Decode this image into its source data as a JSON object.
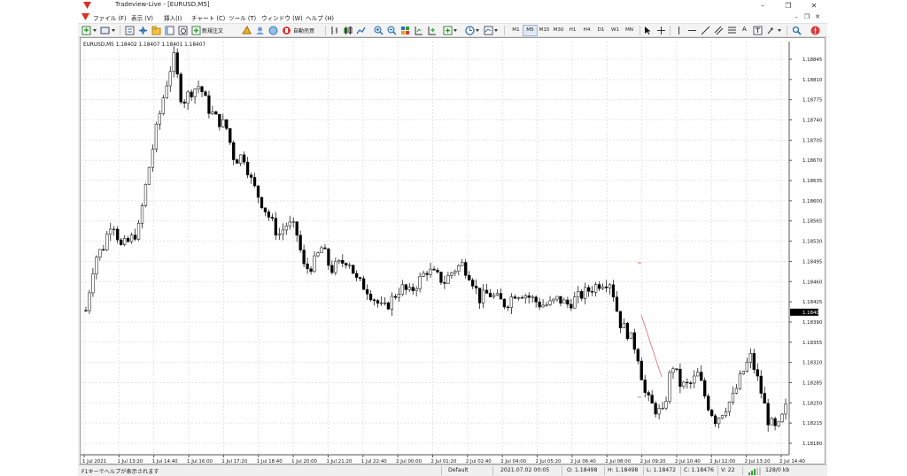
{
  "window": {
    "title": "Tradeview-Live - [EURUSD,M5]"
  },
  "menu": [
    {
      "label": "ファイル (F)"
    },
    {
      "label": "表示 (V)"
    },
    {
      "label": "挿入(I)"
    },
    {
      "label": "チャート (C)"
    },
    {
      "label": "ツール (T)"
    },
    {
      "label": "ウィンドウ (W)"
    },
    {
      "label": "ヘルプ (H)"
    }
  ],
  "toolbar": {
    "new_order_label": "新規注文",
    "auto_trade_label": "自動売買",
    "timeframes": [
      "M1",
      "M5",
      "M15",
      "M30",
      "H1",
      "H4",
      "D1",
      "W1",
      "MN"
    ],
    "active_timeframe": "M5",
    "text_tool_label": "A"
  },
  "chart": {
    "header": "EURUSD,M5  1.18402 1.18407 1.18401 1.18407",
    "current_price_label": "1.18407",
    "colors": {
      "bull": "#ffffff",
      "bear": "#000000",
      "wick": "#000000",
      "grid": "#e4e4e4",
      "price_tag": "#000000"
    }
  },
  "chart_data": {
    "type": "candlestick",
    "symbol": "EURUSD",
    "timeframe": "M5",
    "ylim": [
      1.1816,
      1.1888
    ],
    "y_ticks": [
      "1.18845",
      "1.18810",
      "1.18775",
      "1.18740",
      "1.18705",
      "1.18670",
      "1.18635",
      "1.18600",
      "1.18565",
      "1.18530",
      "1.18495",
      "1.18460",
      "1.18425",
      "1.18390",
      "1.18355",
      "1.18320",
      "1.18285",
      "1.18250",
      "1.18215",
      "1.18180"
    ],
    "x_ticks": [
      "1 Jul 2021",
      "1 Jul 13:20",
      "1 Jul 14:40",
      "1 Jul 16:00",
      "1 Jul 17:20",
      "1 Jul 18:40",
      "1 Jul 20:00",
      "1 Jul 21:20",
      "1 Jul 22:40",
      "2 Jul 00:00",
      "2 Jul 01:20",
      "2 Jul 02:40",
      "2 Jul 04:00",
      "2 Jul 05:20",
      "2 Jul 06:40",
      "2 Jul 08:00",
      "2 Jul 09:20",
      "2 Jul 10:40",
      "2 Jul 12:00",
      "2 Jul 13:20",
      "2 Jul 14:40"
    ],
    "close_path": [
      1.1841,
      1.185,
      1.1852,
      1.1857,
      1.1852,
      1.1853,
      1.1855,
      1.1864,
      1.1872,
      1.1879,
      1.1885,
      1.1877,
      1.1879,
      1.188,
      1.1876,
      1.1874,
      1.1873,
      1.1867,
      1.1868,
      1.1863,
      1.186,
      1.1857,
      1.1854,
      1.1856,
      1.1855,
      1.1848,
      1.1849,
      1.1852,
      1.1848,
      1.1849,
      1.185,
      1.1846,
      1.1845,
      1.1843,
      1.1841,
      1.1843,
      1.1845,
      1.1844,
      1.1846,
      1.1848,
      1.1847,
      1.1846,
      1.1848,
      1.1849,
      1.1847,
      1.1843,
      1.1844,
      1.1843,
      1.1842,
      1.1844,
      1.1844,
      1.1843,
      1.1842,
      1.1842,
      1.1843,
      1.1842,
      1.1843,
      1.1844,
      1.1845,
      1.1846,
      1.1846,
      1.1839,
      1.1837,
      1.1834,
      1.1826,
      1.1824,
      1.1823,
      1.1832,
      1.1828,
      1.1828,
      1.183,
      1.1825,
      1.1822,
      1.1824,
      1.1826,
      1.183,
      1.1833,
      1.1828,
      1.1822,
      1.182,
      1.1824
    ]
  },
  "status": {
    "help": "F1キーでヘルプが表示されます",
    "profile": "Default",
    "datetime": "2021.07.02 00:05",
    "open": "O: 1.18498",
    "high": "H: 1.18498",
    "low": "L: 1.18472",
    "close": "C: 1.18476",
    "volume": "V: 22",
    "traffic": "128/0 kb"
  }
}
